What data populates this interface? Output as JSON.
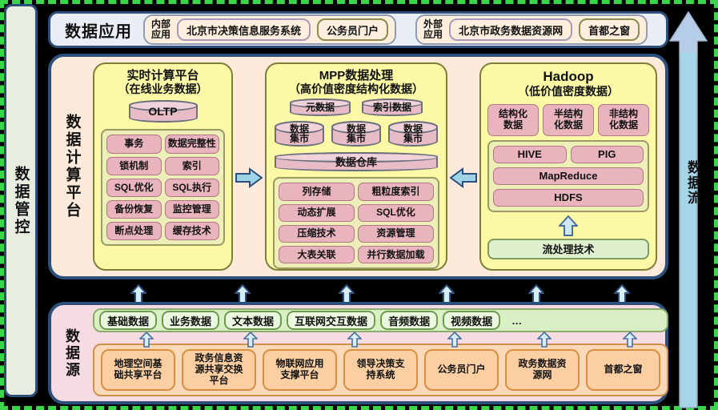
{
  "governance": {
    "label": "数据管控"
  },
  "flow": {
    "label": "数据流"
  },
  "app_bar": {
    "title": "数据应用",
    "internal": {
      "tag": "内部\n应用",
      "tag_line1": "内部",
      "tag_line2": "应用",
      "items": [
        "北京市决策信息服务系统",
        "公务员门户"
      ]
    },
    "external": {
      "tag_line1": "外部",
      "tag_line2": "应用",
      "items": [
        "北京市政务数据资源网",
        "首都之窗"
      ]
    }
  },
  "compute": {
    "label": "数据计算平台",
    "realtime": {
      "title": "实时计算平台",
      "subtitle": "（在线业务数据）",
      "db": "OLTP",
      "features": [
        "事务",
        "数据完整性",
        "锁机制",
        "索引",
        "SQL优化",
        "SQL执行",
        "备份恢复",
        "监控管理",
        "断点处理",
        "缓存技术"
      ]
    },
    "mpp": {
      "title": "MPP数据处理",
      "subtitle": "（高价值密度结构化数据）",
      "top_stores": [
        "元数据",
        "索引数据"
      ],
      "marts": [
        "数据\n集市",
        "数据\n集市",
        "数据\n集市"
      ],
      "mart_line1": "数据",
      "mart_line2": "集市",
      "warehouse": "数据仓库",
      "features": [
        "列存储",
        "粗粒度索引",
        "动态扩展",
        "SQL优化",
        "压缩技术",
        "资源管理",
        "大表关联",
        "并行数据加载"
      ]
    },
    "hadoop": {
      "title": "Hadoop",
      "subtitle": "（低价值密度数据）",
      "data_types": [
        "结构化\n数据",
        "半结构\n化数据",
        "非结构\n化数据"
      ],
      "data_types_split": [
        [
          "结构化",
          "数据"
        ],
        [
          "半结构",
          "化数据"
        ],
        [
          "非结构",
          "化数据"
        ]
      ],
      "stack_row": [
        "HIVE",
        "PIG"
      ],
      "stack": [
        "MapReduce",
        "HDFS"
      ],
      "stream": "流处理技术"
    }
  },
  "source": {
    "label": "数据源",
    "data_kinds": [
      "基础数据",
      "业务数据",
      "文本数据",
      "互联网交互数据",
      "音频数据",
      "视频数据",
      "…"
    ],
    "systems": [
      [
        "地理空间基",
        "础共享平台"
      ],
      [
        "政务信息资",
        "源共享交换",
        "平台"
      ],
      [
        "物联网应用",
        "支撑平台"
      ],
      [
        "领导决策支",
        "持系统"
      ],
      [
        "公务员门户"
      ],
      [
        "政务数据资",
        "源网"
      ],
      [
        "首都之窗"
      ]
    ]
  },
  "colors": {
    "border_blue": "#2c4f7c",
    "panel_peach": "#fdeadb",
    "panel_pink": "#f7dbe3",
    "column_yellow": "#fbf9a6",
    "tile_pink": "#e9b4be",
    "chip_green": "#eaf8df",
    "chip_orange": "#fbcfa2",
    "arrow_blue": "#9fd3e8",
    "dashed_green": "#3ad64a"
  }
}
